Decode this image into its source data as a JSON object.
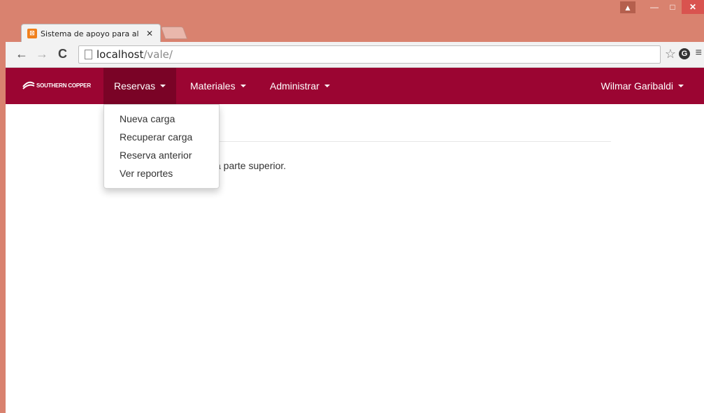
{
  "browser": {
    "tab_title": "Sistema de apoyo para al",
    "tab_close": "✕",
    "url_host": "localhost",
    "url_path": "/vale/",
    "ext_letter": "G"
  },
  "window": {
    "close": "✕",
    "minimize": "—",
    "maximize": "□"
  },
  "navbar": {
    "brand": "SOUTHERN COPPER",
    "items": [
      {
        "label": "Reservas",
        "active": true
      },
      {
        "label": "Materiales",
        "active": false
      },
      {
        "label": "Administrar",
        "active": false
      }
    ],
    "user": "Wilmar Garibaldi"
  },
  "dropdown": {
    "items": [
      "Nueva carga",
      "Recuperar carga",
      "Reserva anterior",
      "Ver reportes"
    ]
  },
  "content": {
    "partial_text": "a parte superior."
  },
  "colors": {
    "navbar": "#9b0532",
    "navbar_active": "#7a0326",
    "chrome_frame": "#d9826f"
  }
}
